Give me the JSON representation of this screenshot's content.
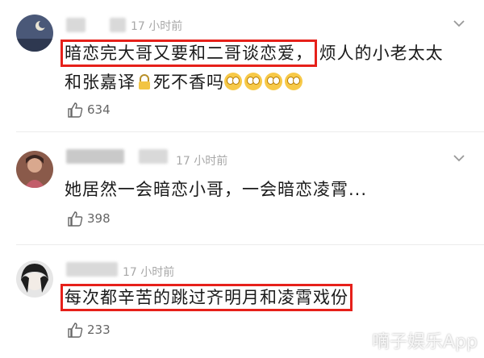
{
  "comments": [
    {
      "time": "17 小时前",
      "highlight": "暗恋完大哥又要和二哥谈恋爱，",
      "text_rest1": "烦人的小老太太",
      "text_line2": "和张嘉译",
      "text_line2b": "死不香吗",
      "emoji_count": 4,
      "likes": "634"
    },
    {
      "time": "17 小时前",
      "text": "她居然一会暗恋小哥，一会暗恋凌霄...",
      "likes": "398"
    },
    {
      "time": "17 小时前",
      "highlight": "每次都辛苦的跳过齐明月和凌霄戏份",
      "likes": "233"
    }
  ],
  "watermark": "嘀子娱乐App",
  "colors": {
    "highlight": "#e6201a",
    "time": "#a8a8a8",
    "text": "#1a1a1a"
  },
  "icons": [
    "thumb-up-icon",
    "more-chevron-icon",
    "lock-emoji",
    "eye-roll-emoji"
  ]
}
